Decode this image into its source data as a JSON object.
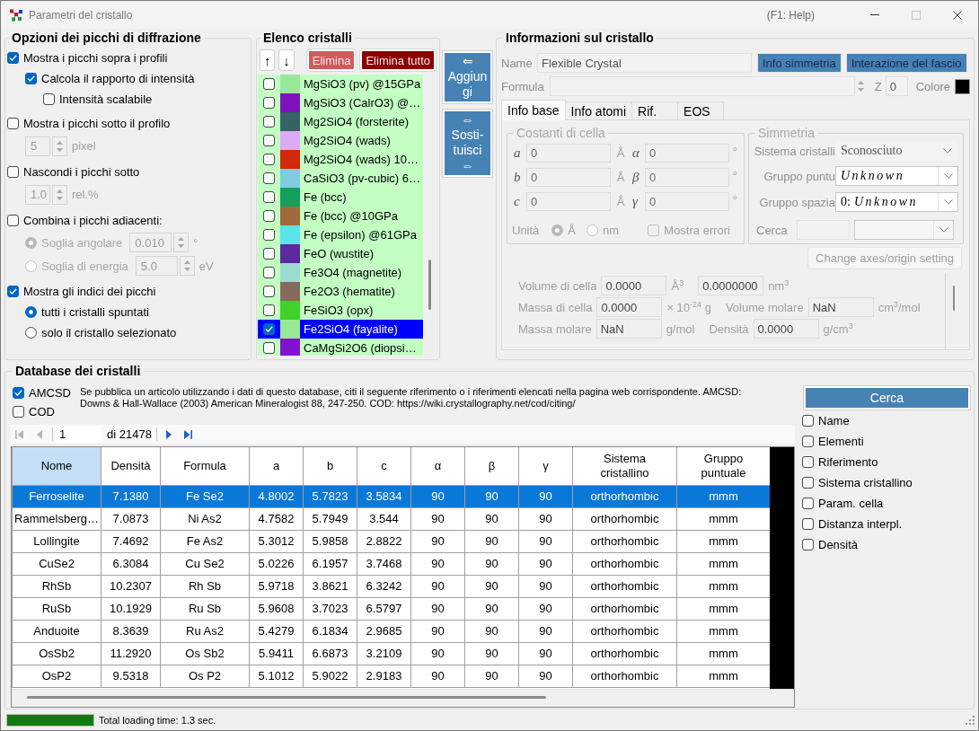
{
  "window": {
    "title": "Parametri del cristallo",
    "help_hint": "(F1: Help)"
  },
  "peak_options": {
    "title": "Opzioni dei picchi di diffrazione",
    "items": [
      {
        "kind": "checkbox",
        "label": "Mostra i picchi sopra i profili",
        "checked": true,
        "disabled": false,
        "children": [
          {
            "kind": "checkbox",
            "label": "Calcola il rapporto di intensità",
            "checked": true,
            "disabled": false,
            "children": [
              {
                "kind": "checkbox",
                "label": "Intensità scalabile",
                "checked": false,
                "disabled": false
              }
            ]
          }
        ]
      },
      {
        "kind": "checkbox",
        "label": "Mostra i picchi sotto il profilo",
        "checked": false,
        "disabled": false,
        "children": [
          {
            "kind": "spinner",
            "value": "5",
            "unit": "pixel",
            "disabled": true
          }
        ]
      },
      {
        "kind": "checkbox",
        "label": "Nascondi i picchi sotto",
        "checked": false,
        "disabled": false,
        "children": [
          {
            "kind": "spinner",
            "value": "1.0",
            "unit": "rel.%",
            "disabled": true
          }
        ]
      },
      {
        "kind": "checkbox",
        "label": "Combina i picchi adiacenti:",
        "checked": false,
        "disabled": false,
        "children": [
          {
            "kind": "radio",
            "label": "Soglia angolare",
            "selected": true,
            "disabled": true,
            "value": "0.010",
            "unit": "°"
          },
          {
            "kind": "radio",
            "label": "Soglia di energia",
            "selected": false,
            "disabled": true,
            "value": "5.0",
            "unit": "eV"
          }
        ]
      },
      {
        "kind": "checkbox",
        "label": "Mostra gli indici dei picchi",
        "checked": true,
        "disabled": false,
        "children": [
          {
            "kind": "radio",
            "label": "tutti i cristalli spuntati",
            "selected": true,
            "disabled": false
          },
          {
            "kind": "radio",
            "label": "solo il cristallo selezionato",
            "selected": false,
            "disabled": false
          }
        ]
      }
    ]
  },
  "crystal_list": {
    "title": "Elenco cristalli",
    "tools": [
      {
        "kind": "arrow",
        "label": "↑"
      },
      {
        "kind": "arrow",
        "label": "↓"
      },
      {
        "kind": "delete",
        "label": "Elimina"
      },
      {
        "kind": "delete_all",
        "label": "Elimina tutto"
      }
    ],
    "items": [
      {
        "name": "MgSiO3 (pv) @15GPa",
        "color": "#98e898",
        "checked": false,
        "selected": false
      },
      {
        "name": "MgSiO3 (CalrO3) @…",
        "color": "#7e12bc",
        "checked": false,
        "selected": false
      },
      {
        "name": "Mg2SiO4 (forsterite)",
        "color": "#366466",
        "checked": false,
        "selected": false
      },
      {
        "name": "Mg2SiO4 (wads)",
        "color": "#dfaaf5",
        "checked": false,
        "selected": false
      },
      {
        "name": "Mg2SiO4 (wads) 10…",
        "color": "#d02a0a",
        "checked": false,
        "selected": false
      },
      {
        "name": "CaSiO3 (pv-cubic) 6…",
        "color": "#82cce0",
        "checked": false,
        "selected": false
      },
      {
        "name": "Fe (bcc)",
        "color": "#14a05c",
        "checked": false,
        "selected": false
      },
      {
        "name": "Fe (bcc) @10GPa",
        "color": "#9e6a3a",
        "checked": false,
        "selected": false
      },
      {
        "name": "Fe (epsilon) @61GPa",
        "color": "#5ae4ea",
        "checked": false,
        "selected": false
      },
      {
        "name": "FeO (wustite)",
        "color": "#5a2a9e",
        "checked": false,
        "selected": false
      },
      {
        "name": "Fe3O4 (magnetite)",
        "color": "#9adccf",
        "checked": false,
        "selected": false
      },
      {
        "name": "Fe2O3 (hematite)",
        "color": "#866a5c",
        "checked": false,
        "selected": false
      },
      {
        "name": "FeSiO3 (opx)",
        "color": "#3ed22a",
        "checked": false,
        "selected": false
      },
      {
        "name": "Fe2SiO4 (fayalite)",
        "color": "#98e898",
        "checked": true,
        "selected": true
      },
      {
        "name": "CaMgSi2O6 (diopsi…",
        "color": "#8212d2",
        "checked": false,
        "selected": false
      }
    ]
  },
  "list_actions": [
    {
      "arrow_top": "⇐",
      "label": "Aggiungi"
    },
    {
      "arrow_top": "⇔",
      "label": "Sosti-tuisci",
      "arrow_bottom": "⇔"
    }
  ],
  "crystal_info": {
    "title": "Informazioni sul cristallo",
    "name": {
      "label": "Name",
      "value": "Flexible Crystal"
    },
    "buttons": [
      "Info simmetria",
      "Interazione del fascio"
    ],
    "formula": {
      "label": "Formula",
      "disabled": true
    },
    "z": {
      "label": "Z",
      "value": "0"
    },
    "crystal_color": {
      "label": "Colore",
      "color": "#000000"
    },
    "tabs": [
      {
        "label": "Info base",
        "selected": true
      },
      {
        "label": "Info atomi",
        "selected": false
      },
      {
        "label": "Rif.",
        "selected": false
      },
      {
        "label": "EOS",
        "selected": false
      }
    ],
    "base_info": {
      "disabled": true,
      "cell_constants": {
        "title": "Costanti di cella",
        "rows": [
          {
            "axis": "a",
            "length": "0",
            "length_unit": "Å",
            "angle": "α",
            "angle_value": "0",
            "angle_unit": "°"
          },
          {
            "axis": "b",
            "length": "0",
            "length_unit": "Å",
            "angle": "β",
            "angle_value": "0",
            "angle_unit": "°"
          },
          {
            "axis": "c",
            "length": "0",
            "length_unit": "Å",
            "angle": "γ",
            "angle_value": "0",
            "angle_unit": "°"
          }
        ],
        "units_label": "Unità",
        "units": [
          {
            "label": "Å",
            "selected": true
          },
          {
            "label": "nm",
            "selected": false
          }
        ],
        "show_errors": {
          "label": "Mostra errori",
          "checked": false
        }
      },
      "symmetry": {
        "title": "Simmetria",
        "fields": [
          {
            "kind": "plain_select",
            "label": "Sistema cristalli",
            "value": "Sconosciuto"
          },
          {
            "kind": "symbol_select",
            "label": "Gruppo puntu",
            "value": "Unknown"
          },
          {
            "kind": "symbol_select",
            "label": "Gruppo spazia",
            "prefix": "0:",
            "value": "Unknown"
          },
          {
            "kind": "search",
            "label": "Cerca"
          }
        ]
      },
      "change_axes_button": "Change axes/origin setting",
      "derived": [
        {
          "cells": [
            {
              "label": "Volume di cella",
              "value": "0.0000",
              "unit": "Å$^{3}$"
            },
            {
              "value": "0.0000000",
              "unit": "nm$^{3}$"
            }
          ]
        },
        {
          "cells": [
            {
              "label": "Massa di cella",
              "value": "0.0000",
              "unit": "× 10$^{-24}$ g"
            },
            {
              "label": "Volume molare",
              "value": "NaN",
              "unit": "cm$^{3}$/mol"
            }
          ]
        },
        {
          "cells": [
            {
              "label": "Massa molare",
              "value": "NaN",
              "unit": "g/mol"
            },
            {
              "label": "Densità",
              "value": "0.0000",
              "unit": "g/cm$^{3}$"
            }
          ]
        }
      ]
    }
  },
  "database": {
    "title": "Database dei cristalli",
    "sources": [
      {
        "label": "AMCSD",
        "checked": true
      },
      {
        "label": "COD",
        "checked": false
      }
    ],
    "citation": "Se pubblica un articolo utilizzando i dati di questo database, citi il seguente riferimento o i riferimenti elencati nella pagina web corrispondente. AMCSD: Downs & Hall-Wallace (2003) American Mineralogist 88, 247-250. COD: https://wiki.crystallography.net/cod/citing/",
    "pager": {
      "nav": [
        {
          "kind": "first",
          "disabled": true
        },
        {
          "kind": "previous",
          "disabled": true
        },
        {
          "kind": "next",
          "disabled": false
        },
        {
          "kind": "last",
          "disabled": false
        }
      ],
      "page": "1",
      "total": "di 21478"
    },
    "table": {
      "columns": [
        {
          "label": "Nome",
          "selected": true
        },
        {
          "label": "Densità",
          "selected": false
        },
        {
          "label": "Formula",
          "selected": false
        },
        {
          "label": "a",
          "selected": false
        },
        {
          "label": "b",
          "selected": false
        },
        {
          "label": "c",
          "selected": false
        },
        {
          "label": "α",
          "selected": false
        },
        {
          "label": "β",
          "selected": false
        },
        {
          "label": "γ",
          "selected": false
        },
        {
          "label": "Sistema cristallino",
          "selected": false
        },
        {
          "label": "Gruppo puntuale",
          "selected": false
        }
      ],
      "rows": [
        {
          "selected": true,
          "cells": [
            "Ferroselite",
            "7.1380",
            "Fe Se2",
            "4.8002",
            "5.7823",
            "3.5834",
            "90",
            "90",
            "90",
            "orthorhombic",
            "mmm"
          ]
        },
        {
          "selected": false,
          "cells": [
            "Rammelsberg…",
            "7.0873",
            "Ni As2",
            "4.7582",
            "5.7949",
            "3.544",
            "90",
            "90",
            "90",
            "orthorhombic",
            "mmm"
          ]
        },
        {
          "selected": false,
          "cells": [
            "Lollingite",
            "7.4692",
            "Fe As2",
            "5.3012",
            "5.9858",
            "2.8822",
            "90",
            "90",
            "90",
            "orthorhombic",
            "mmm"
          ]
        },
        {
          "selected": false,
          "cells": [
            "CuSe2",
            "6.3084",
            "Cu Se2",
            "5.0226",
            "6.1957",
            "3.7468",
            "90",
            "90",
            "90",
            "orthorhombic",
            "mmm"
          ]
        },
        {
          "selected": false,
          "cells": [
            "RhSb",
            "10.2307",
            "Rh Sb",
            "5.9718",
            "3.8621",
            "6.3242",
            "90",
            "90",
            "90",
            "orthorhombic",
            "mmm"
          ]
        },
        {
          "selected": false,
          "cells": [
            "RuSb",
            "10.1929",
            "Ru Sb",
            "5.9608",
            "3.7023",
            "6.5797",
            "90",
            "90",
            "90",
            "orthorhombic",
            "mmm"
          ]
        },
        {
          "selected": false,
          "cells": [
            "Anduoite",
            "8.3639",
            "Ru As2",
            "5.4279",
            "6.1834",
            "2.9685",
            "90",
            "90",
            "90",
            "orthorhombic",
            "mmm"
          ]
        },
        {
          "selected": false,
          "cells": [
            "OsSb2",
            "11.2920",
            "Os Sb2",
            "5.9411",
            "6.6873",
            "3.2109",
            "90",
            "90",
            "90",
            "orthorhombic",
            "mmm"
          ]
        },
        {
          "selected": false,
          "cells": [
            "OsP2",
            "9.5318",
            "Os P2",
            "5.1012",
            "5.9022",
            "2.9183",
            "90",
            "90",
            "90",
            "orthorhombic",
            "mmm"
          ]
        }
      ]
    },
    "search_button": "Cerca",
    "search_fields": [
      {
        "label": "Name",
        "checked": false
      },
      {
        "label": "Elementi",
        "checked": false
      },
      {
        "label": "Riferimento",
        "checked": false
      },
      {
        "label": "Sistema cristallino",
        "checked": false
      },
      {
        "label": "Param. cella",
        "checked": false
      },
      {
        "label": "Distanza interpl.",
        "checked": false
      },
      {
        "label": "Densità",
        "checked": false
      }
    ]
  },
  "status_bar": {
    "progress": {
      "level": 1
    },
    "text": "Total loading time: 1.3 sec."
  }
}
